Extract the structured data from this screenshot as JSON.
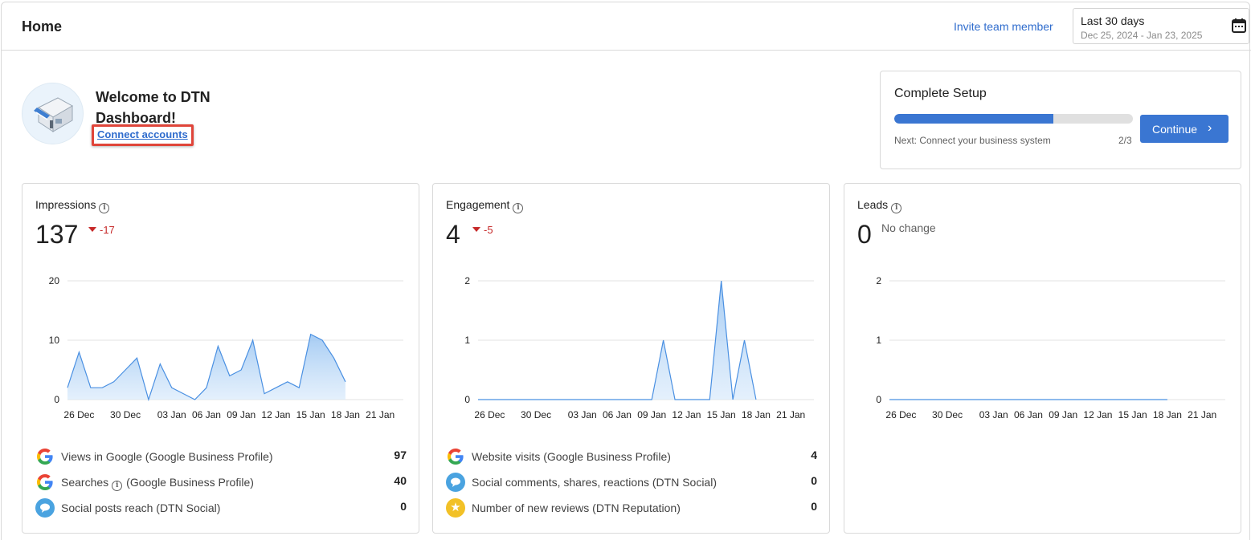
{
  "header": {
    "title": "Home",
    "invite_label": "Invite team member",
    "date_label": "Last 30 days",
    "date_range": "Dec 25, 2024 - Jan 23, 2025"
  },
  "welcome": {
    "title": "Welcome to DTN Dashboard!",
    "connect_label": "Connect accounts"
  },
  "setup": {
    "title": "Complete Setup",
    "progress": 0.667,
    "next_text": "Next: Connect your business system",
    "count": "2/3",
    "continue_label": "Continue"
  },
  "cards": [
    {
      "title": "Impressions",
      "value": "137",
      "delta": "-17",
      "metrics": [
        {
          "icon": "google-icon",
          "label": "Views in Google (Google Business Profile)",
          "value": "97"
        },
        {
          "icon": "google-icon",
          "label_prefix": "Searches",
          "label_suffix": "(Google Business Profile)",
          "value": "40"
        },
        {
          "icon": "social-icon",
          "label": "Social posts reach (DTN Social)",
          "value": "0"
        }
      ]
    },
    {
      "title": "Engagement",
      "value": "4",
      "delta": "-5",
      "metrics": [
        {
          "icon": "google-icon",
          "label": "Website visits (Google Business Profile)",
          "value": "4"
        },
        {
          "icon": "social-icon",
          "label": "Social comments, shares, reactions (DTN Social)",
          "value": "0"
        },
        {
          "icon": "star-icon",
          "label": "Number of new reviews (DTN Reputation)",
          "value": "0"
        }
      ]
    },
    {
      "title": "Leads",
      "value": "0",
      "delta_text": "No change",
      "metrics": []
    }
  ],
  "chart_data": [
    {
      "type": "area",
      "title": "Impressions",
      "x": [
        "Dec 25",
        "Dec 26",
        "Dec 27",
        "Dec 28",
        "Dec 29",
        "Dec 30",
        "Dec 31",
        "Jan 01",
        "Jan 02",
        "Jan 03",
        "Jan 04",
        "Jan 05",
        "Jan 06",
        "Jan 07",
        "Jan 08",
        "Jan 09",
        "Jan 10",
        "Jan 11",
        "Jan 12",
        "Jan 13",
        "Jan 14",
        "Jan 15",
        "Jan 16",
        "Jan 17",
        "Jan 18"
      ],
      "values": [
        2,
        8,
        2,
        2,
        3,
        5,
        7,
        0,
        6,
        2,
        1,
        0,
        2,
        9,
        4,
        5,
        10,
        1,
        2,
        3,
        2,
        11,
        10,
        7,
        3
      ],
      "x_ticks": [
        "26 Dec",
        "30 Dec",
        "03 Jan",
        "06 Jan",
        "09 Jan",
        "12 Jan",
        "15 Jan",
        "18 Jan",
        "21 Jan"
      ],
      "y_ticks": [
        "0",
        "10",
        "20"
      ],
      "ylim": [
        0,
        20
      ]
    },
    {
      "type": "area",
      "title": "Engagement",
      "x": [
        "Dec 25",
        "Dec 26",
        "Dec 27",
        "Dec 28",
        "Dec 29",
        "Dec 30",
        "Dec 31",
        "Jan 01",
        "Jan 02",
        "Jan 03",
        "Jan 04",
        "Jan 05",
        "Jan 06",
        "Jan 07",
        "Jan 08",
        "Jan 09",
        "Jan 10",
        "Jan 11",
        "Jan 12",
        "Jan 13",
        "Jan 14",
        "Jan 15",
        "Jan 16",
        "Jan 17",
        "Jan 18"
      ],
      "values": [
        0,
        0,
        0,
        0,
        0,
        0,
        0,
        0,
        0,
        0,
        0,
        0,
        0,
        0,
        0,
        0,
        1,
        0,
        0,
        0,
        0,
        2,
        0,
        1,
        0
      ],
      "x_ticks": [
        "26 Dec",
        "30 Dec",
        "03 Jan",
        "06 Jan",
        "09 Jan",
        "12 Jan",
        "15 Jan",
        "18 Jan",
        "21 Jan"
      ],
      "y_ticks": [
        "0",
        "1",
        "2"
      ],
      "ylim": [
        0,
        2
      ]
    },
    {
      "type": "area",
      "title": "Leads",
      "x": [
        "Dec 25",
        "Dec 26",
        "Dec 27",
        "Dec 28",
        "Dec 29",
        "Dec 30",
        "Dec 31",
        "Jan 01",
        "Jan 02",
        "Jan 03",
        "Jan 04",
        "Jan 05",
        "Jan 06",
        "Jan 07",
        "Jan 08",
        "Jan 09",
        "Jan 10",
        "Jan 11",
        "Jan 12",
        "Jan 13",
        "Jan 14",
        "Jan 15",
        "Jan 16",
        "Jan 17",
        "Jan 18"
      ],
      "values": [
        0,
        0,
        0,
        0,
        0,
        0,
        0,
        0,
        0,
        0,
        0,
        0,
        0,
        0,
        0,
        0,
        0,
        0,
        0,
        0,
        0,
        0,
        0,
        0,
        0
      ],
      "x_ticks": [
        "26 Dec",
        "30 Dec",
        "03 Jan",
        "06 Jan",
        "09 Jan",
        "12 Jan",
        "15 Jan",
        "18 Jan",
        "21 Jan"
      ],
      "y_ticks": [
        "0",
        "1",
        "2"
      ],
      "ylim": [
        0,
        2
      ]
    }
  ],
  "colors": {
    "accent": "#3a76d2",
    "link": "#2f6ccd",
    "negative": "#c62828",
    "series_line": "#4a90e2",
    "highlight_border": "#e0453a"
  }
}
